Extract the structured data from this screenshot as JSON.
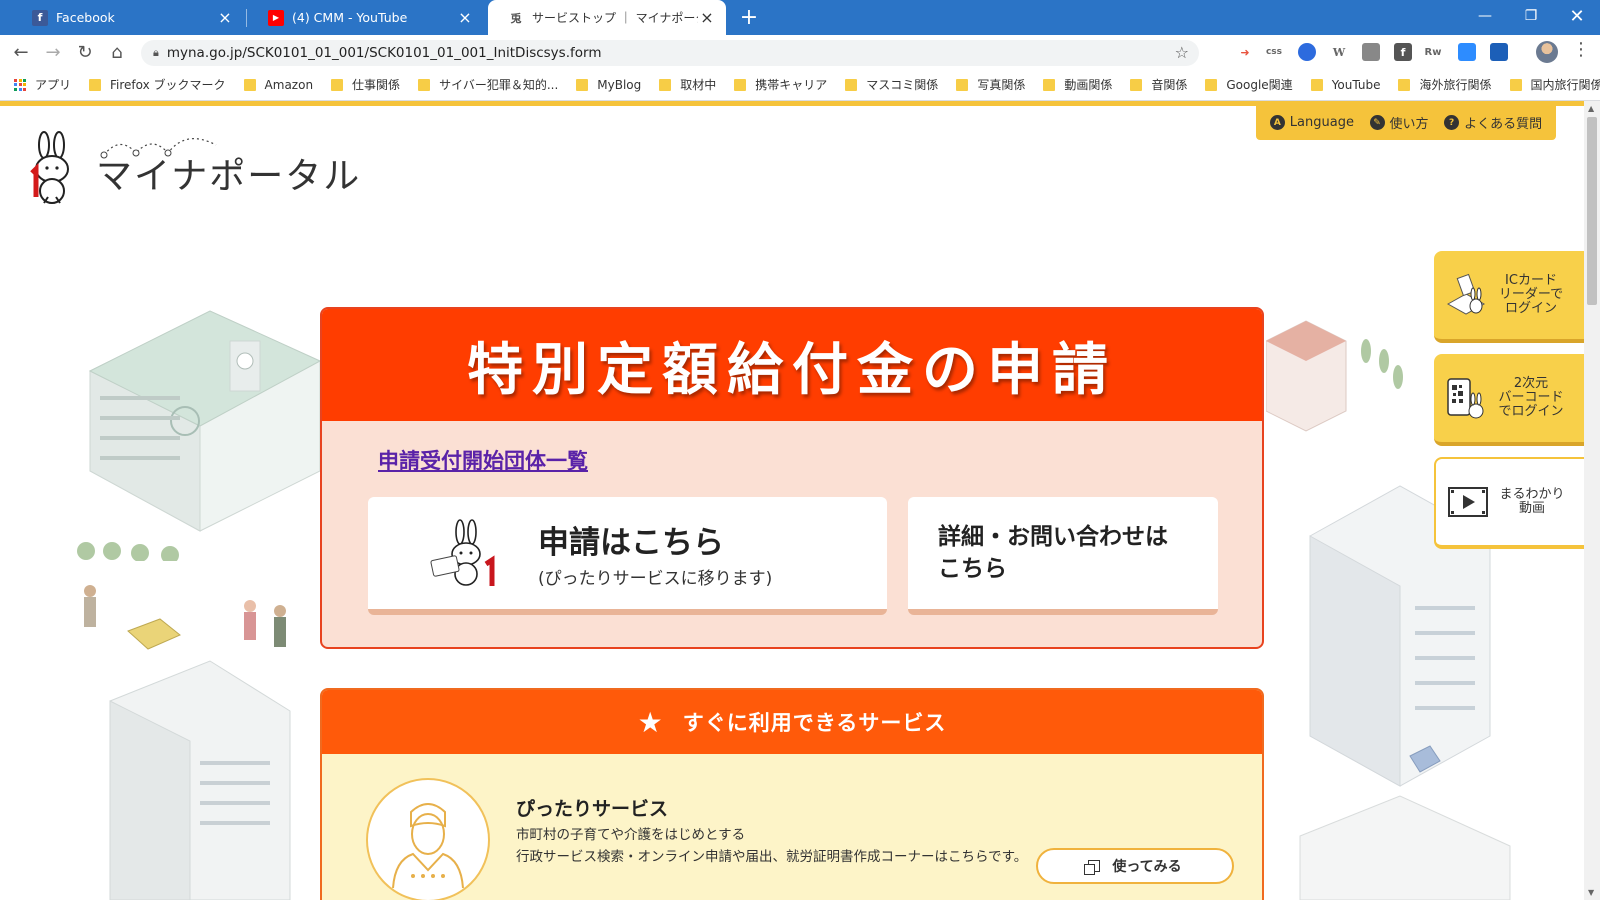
{
  "browser": {
    "tabs": [
      {
        "title": "Facebook",
        "favicon": "f",
        "active": false
      },
      {
        "title": "(4) CMM - YouTube",
        "favicon": "▶",
        "active": false
      },
      {
        "title": "サービストップ ｜ マイナポータル",
        "favicon": "兎",
        "active": true
      }
    ],
    "new_tab_icon": "+",
    "url": "myna.go.jp/SCK0101_01_001/SCK0101_01_001_InitDiscsys.form",
    "extensions": [
      "css",
      "W",
      "Rw"
    ],
    "bookmarks": [
      {
        "label": "アプリ",
        "type": "apps"
      },
      {
        "label": "Firefox ブックマーク",
        "type": "folder"
      },
      {
        "label": "Amazon",
        "type": "folder"
      },
      {
        "label": "仕事関係",
        "type": "folder"
      },
      {
        "label": "サイバー犯罪＆知的...",
        "type": "folder"
      },
      {
        "label": "MyBlog",
        "type": "folder"
      },
      {
        "label": "取材中",
        "type": "folder"
      },
      {
        "label": "携帯キャリア",
        "type": "folder"
      },
      {
        "label": "マスコミ関係",
        "type": "folder"
      },
      {
        "label": "写真関係",
        "type": "folder"
      },
      {
        "label": "動画関係",
        "type": "folder"
      },
      {
        "label": "音関係",
        "type": "folder"
      },
      {
        "label": "Google関連",
        "type": "folder"
      },
      {
        "label": "YouTube",
        "type": "folder"
      },
      {
        "label": "海外旅行関係",
        "type": "folder"
      },
      {
        "label": "国内旅行関係",
        "type": "folder"
      }
    ]
  },
  "site": {
    "logo_text": "マイナポータル",
    "util_links": [
      {
        "label": "Language",
        "icon": "A"
      },
      {
        "label": "使い方",
        "icon": "✎"
      },
      {
        "label": "よくある質問",
        "icon": "?"
      }
    ],
    "side_buttons": [
      {
        "label": "ICカード\nリーダーで\nログイン",
        "icon": "card-reader-icon"
      },
      {
        "label": "2次元\nバーコード\nでログイン",
        "icon": "qr-code-icon"
      },
      {
        "label": "まるわかり\n動画",
        "icon": "video-icon"
      }
    ],
    "main": {
      "title": "特別定額給付金の申請",
      "list_link": "申請受付開始団体一覧",
      "apply_main": "申請はこちら",
      "apply_sub": "(ぴったりサービスに移ります)",
      "detail_line1": "詳細・お問い合わせは",
      "detail_line2": "こちら"
    },
    "services": {
      "heading": "すぐに利用できるサービス",
      "name": "ぴったりサービス",
      "desc_line1": "市町村の子育てや介護をはじめとする",
      "desc_line2": "行政サービス検索・オンライン申請や届出、就労証明書作成コーナーはこちらです。",
      "try_label": "使ってみる"
    }
  },
  "colors": {
    "chrome_blue": "#2b74c6",
    "yellow": "#f5c33b",
    "banner_red": "#ff3d00",
    "services_orange": "#ff5a0a",
    "link_purple": "#5a22a8"
  }
}
